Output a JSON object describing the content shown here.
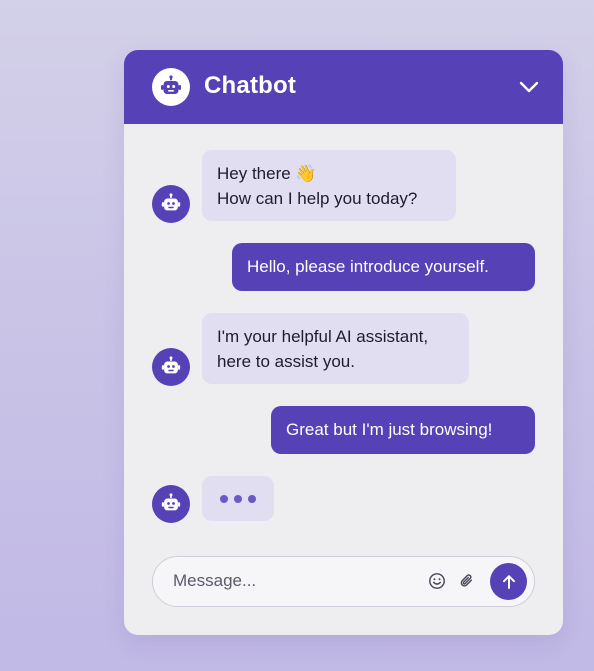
{
  "header": {
    "title": "Chatbot",
    "avatar_icon": "robot-icon",
    "collapse_icon": "chevron-down-icon"
  },
  "messages": [
    {
      "sender": "bot",
      "lines": [
        "Hey there 👋",
        "How can I help you today?"
      ]
    },
    {
      "sender": "user",
      "lines": [
        "Hello, please introduce yourself."
      ]
    },
    {
      "sender": "bot",
      "lines": [
        "I'm your helpful AI assistant,",
        "here to assist you."
      ]
    },
    {
      "sender": "user",
      "lines": [
        "Great but I'm just browsing!"
      ]
    },
    {
      "sender": "bot",
      "typing": true
    }
  ],
  "composer": {
    "placeholder": "Message...",
    "value": "",
    "emoji_icon": "smiley-icon",
    "attach_icon": "paperclip-icon",
    "send_icon": "arrow-up-icon"
  },
  "colors": {
    "primary": "#5741b6",
    "bot_bubble": "#e0def0",
    "panel_background": "#eeeef1",
    "page_background": "#c8c2e6"
  }
}
